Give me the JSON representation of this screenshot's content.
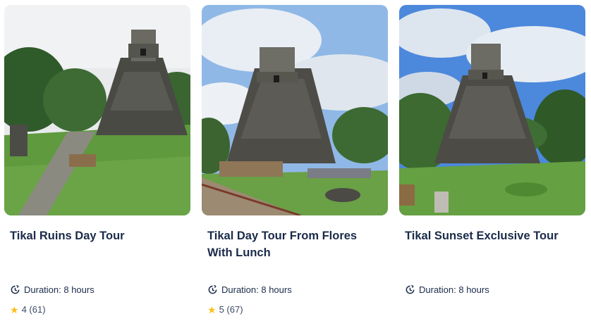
{
  "tours": [
    {
      "title": "Tikal Ruins Day Tour",
      "duration": "Duration: 8 hours",
      "rating": "4 (61)",
      "image_icon": "tikal-temple-photo",
      "sky": "#e9ecef"
    },
    {
      "title": "Tikal Day Tour From Flores With Lunch",
      "duration": "Duration: 8 hours",
      "rating": "5 (67)",
      "image_icon": "tikal-temple-photo",
      "sky": "#8fb8e6"
    },
    {
      "title": "Tikal Sunset Exclusive Tour",
      "duration": "Duration: 8 hours",
      "rating": "",
      "image_icon": "tikal-temple-photo",
      "sky": "#4c88dc"
    }
  ],
  "colors": {
    "title": "#1a2b49",
    "star": "#fbbf1c",
    "grass": "#5d9b3c",
    "stone": "#5a5a55"
  }
}
